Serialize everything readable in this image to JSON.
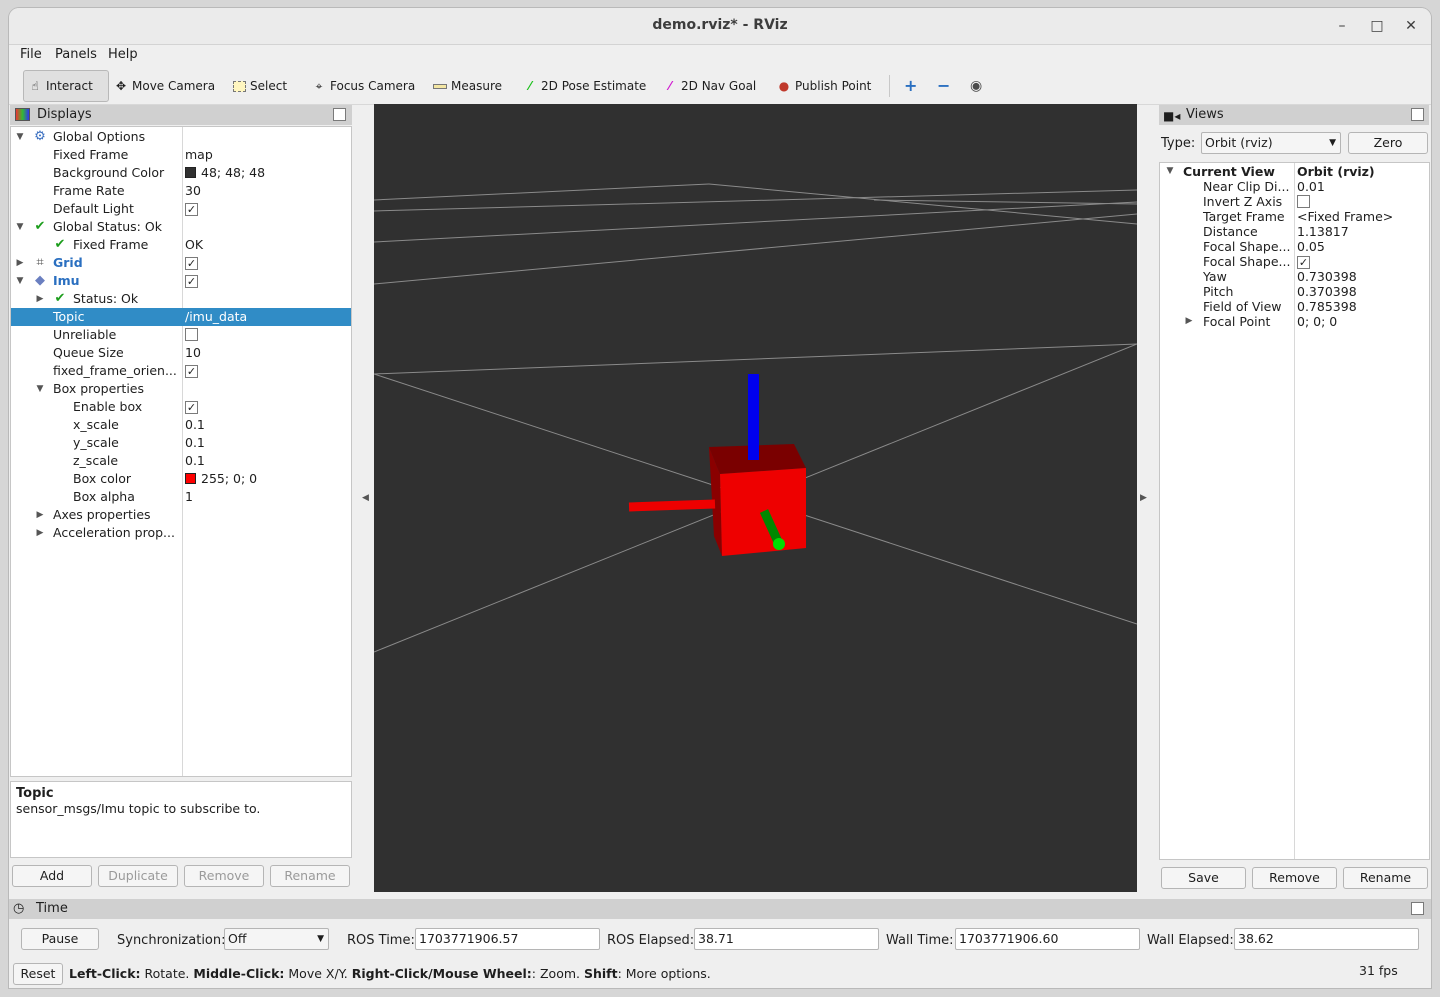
{
  "window": {
    "title": "demo.rviz* - RViz"
  },
  "menu": [
    "File",
    "Panels",
    "Help"
  ],
  "toolbar": {
    "tools": [
      {
        "label": "Interact",
        "icon": "hand-icon"
      },
      {
        "label": "Move Camera",
        "icon": "move-camera-icon"
      },
      {
        "label": "Select",
        "icon": "select-icon"
      },
      {
        "label": "Focus Camera",
        "icon": "focus-camera-icon"
      },
      {
        "label": "Measure",
        "icon": "ruler-icon"
      },
      {
        "label": "2D Pose Estimate",
        "icon": "green-arrow-icon"
      },
      {
        "label": "2D Nav Goal",
        "icon": "magenta-arrow-icon"
      },
      {
        "label": "Publish Point",
        "icon": "map-pin-icon"
      }
    ],
    "active": "Interact"
  },
  "displays": {
    "title": "Displays",
    "rows": [
      {
        "label": "Global Options",
        "value": ""
      },
      {
        "label": "Fixed Frame",
        "value": "map"
      },
      {
        "label": "Background Color",
        "value": "48; 48; 48",
        "color": "#303030"
      },
      {
        "label": "Frame Rate",
        "value": "30"
      },
      {
        "label": "Default Light",
        "value": "✓"
      },
      {
        "label": "Global Status: Ok",
        "value": ""
      },
      {
        "label": "Fixed Frame",
        "value": "OK"
      },
      {
        "label": "Grid",
        "value": "✓"
      },
      {
        "label": "Imu",
        "value": "✓"
      },
      {
        "label": "Status: Ok",
        "value": ""
      },
      {
        "label": "Topic",
        "value": "/imu_data"
      },
      {
        "label": "Unreliable",
        "value": ""
      },
      {
        "label": "Queue Size",
        "value": "10"
      },
      {
        "label": "fixed_frame_orien...",
        "value": "✓"
      },
      {
        "label": "Box properties",
        "value": ""
      },
      {
        "label": "Enable box",
        "value": "✓"
      },
      {
        "label": "x_scale",
        "value": "0.1"
      },
      {
        "label": "y_scale",
        "value": "0.1"
      },
      {
        "label": "z_scale",
        "value": "0.1"
      },
      {
        "label": "Box color",
        "value": "255; 0; 0",
        "color": "#ff0000"
      },
      {
        "label": "Box alpha",
        "value": "1"
      },
      {
        "label": "Axes properties",
        "value": ""
      },
      {
        "label": "Acceleration prop...",
        "value": ""
      }
    ],
    "description": {
      "title": "Topic",
      "text": "sensor_msgs/Imu topic to subscribe to."
    },
    "buttons": {
      "add": "Add",
      "duplicate": "Duplicate",
      "remove": "Remove",
      "rename": "Rename"
    }
  },
  "views": {
    "title": "Views",
    "type_label": "Type:",
    "type_value": "Orbit (rviz)",
    "zero_label": "Zero",
    "current_view": {
      "label": "Current View",
      "value": "Orbit (rviz)"
    },
    "rows": [
      {
        "label": "Near Clip Di...",
        "value": "0.01"
      },
      {
        "label": "Invert Z Axis",
        "value": ""
      },
      {
        "label": "Target Frame",
        "value": "<Fixed Frame>"
      },
      {
        "label": "Distance",
        "value": "1.13817"
      },
      {
        "label": "Focal Shape...",
        "value": "0.05"
      },
      {
        "label": "Focal Shape...",
        "value": "✓"
      },
      {
        "label": "Yaw",
        "value": "0.730398"
      },
      {
        "label": "Pitch",
        "value": "0.370398"
      },
      {
        "label": "Field of View",
        "value": "0.785398"
      },
      {
        "label": "Focal Point",
        "value": "0; 0; 0"
      }
    ],
    "buttons": {
      "save": "Save",
      "remove": "Remove",
      "rename": "Rename"
    }
  },
  "time": {
    "title": "Time",
    "pause": "Pause",
    "sync_label": "Synchronization:",
    "sync_value": "Off",
    "ros_time_label": "ROS Time:",
    "ros_time": "1703771906.57",
    "ros_elapsed_label": "ROS Elapsed:",
    "ros_elapsed": "38.71",
    "wall_time_label": "Wall Time:",
    "wall_time": "1703771906.60",
    "wall_elapsed_label": "Wall Elapsed:",
    "wall_elapsed": "38.62"
  },
  "status": {
    "reset": "Reset",
    "hint_parts": [
      {
        "b": "Left-Click:",
        "t": " Rotate. "
      },
      {
        "b": "Middle-Click:",
        "t": " Move X/Y. "
      },
      {
        "b": "Right-Click/Mouse Wheel:",
        "t": ": Zoom. "
      },
      {
        "b": "Shift",
        "t": ": More options."
      }
    ],
    "fps": "31 fps"
  },
  "colors": {
    "selection": "#308cc6",
    "viewport_bg": "#303030",
    "box": "#ff0000",
    "x_axis": "#ff0000",
    "y_axis": "#00cc00",
    "z_axis": "#0000ff"
  }
}
